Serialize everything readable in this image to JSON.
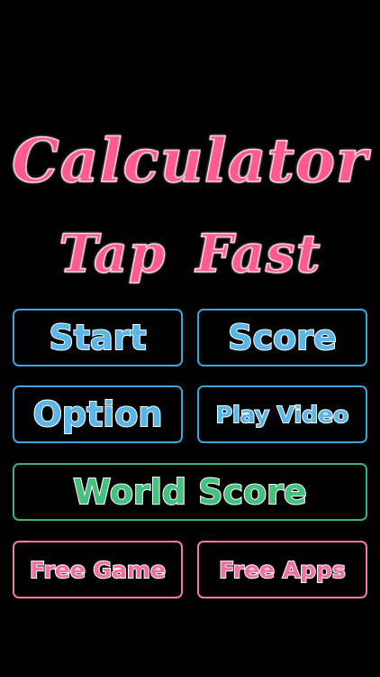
{
  "title": {
    "line1": "Calculator",
    "line2": "Tap Fast"
  },
  "menu": {
    "start_label": "Start",
    "score_label": "Score",
    "option_label": "Option",
    "play_video_label": "Play Video",
    "world_score_label": "World Score",
    "free_game_label": "Free Game",
    "free_apps_label": "Free Apps"
  },
  "colors": {
    "background": "#000000",
    "title_pink": "#FF5A92",
    "blue_button": "#3FA4D8",
    "green_button": "#37B578",
    "pink_button": "#F07CA5"
  }
}
